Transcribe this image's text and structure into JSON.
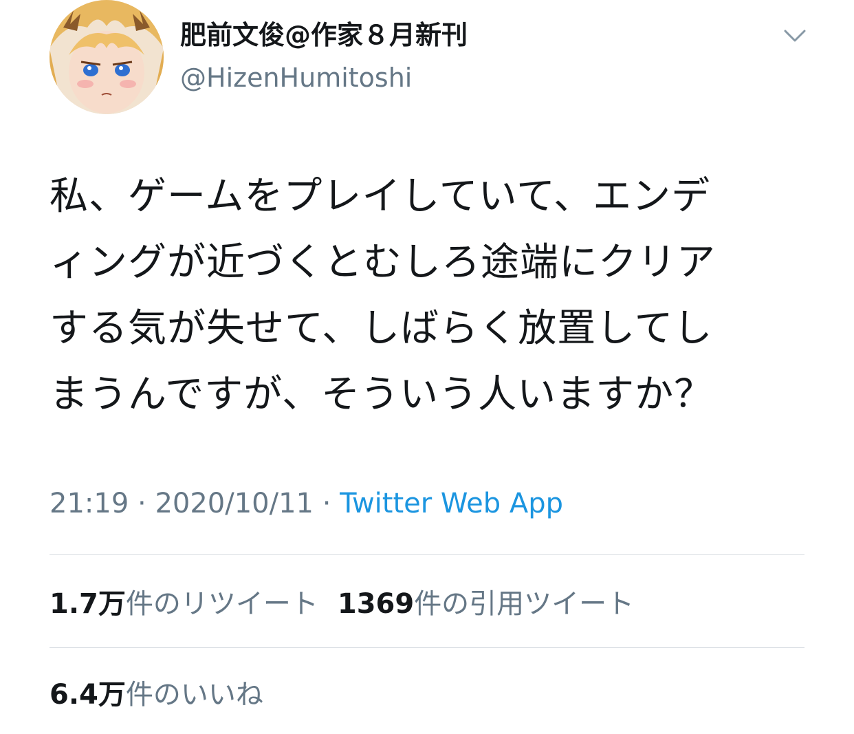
{
  "user": {
    "display_name": "肥前文俊@作家８月新刊",
    "handle": "@HizenHumitoshi"
  },
  "tweet": {
    "lines": [
      "私、ゲームをプレイしていて、エンデ",
      "ィングが近づくとむしろ途端にクリア",
      "する気が失せて、しばらく放置してし",
      "まうんですが、そういう人いますか？"
    ]
  },
  "meta": {
    "time": "21:19",
    "separator": " · ",
    "date": "2020/10/11",
    "source": "Twitter Web App"
  },
  "stats": {
    "retweets_count": "1.7万",
    "retweets_label": "件のリツイート",
    "quotes_count": "1369",
    "quotes_label": "件の引用ツイート",
    "likes_count": "6.4万",
    "likes_label": "件のいいね"
  },
  "icons": {
    "more": "chevron-down-icon",
    "avatar": "avatar"
  },
  "colors": {
    "text": "#14171a",
    "secondary": "#657786",
    "link": "#1b95e0",
    "divider": "#d8dde2"
  }
}
